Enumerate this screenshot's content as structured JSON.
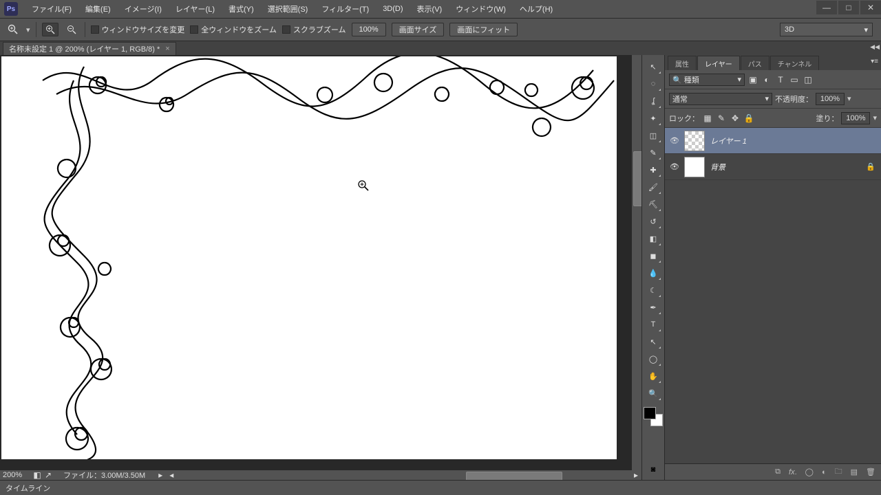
{
  "menu": [
    "ファイル(F)",
    "編集(E)",
    "イメージ(I)",
    "レイヤー(L)",
    "書式(Y)",
    "選択範囲(S)",
    "フィルター(T)",
    "3D(D)",
    "表示(V)",
    "ウィンドウ(W)",
    "ヘルプ(H)"
  ],
  "options": {
    "chk1": "ウィンドウサイズを変更",
    "chk2": "全ウィンドウをズーム",
    "chk3": "スクラブズーム",
    "btn100": "100%",
    "btnScreen": "画面サイズ",
    "btnFit": "画面にフィット",
    "mode": "3D"
  },
  "doc": {
    "title": "名称未設定 1 @ 200% (レイヤー 1, RGB/8) *"
  },
  "hbar": {
    "zoom": "200%",
    "file": "ファイル：3.00M/3.50M"
  },
  "panel": {
    "tabs": [
      "属性",
      "レイヤー",
      "パス",
      "チャンネル"
    ],
    "activeTab": 1,
    "filterKind": "種類",
    "blend": "通常",
    "opacityLabel": "不透明度：",
    "opacityVal": "100%",
    "fillLabel": "塗り：",
    "fillVal": "100%",
    "lockLabel": "ロック：",
    "layers": [
      {
        "name": "レイヤー 1",
        "sel": true,
        "trans": true,
        "locked": false
      },
      {
        "name": "背景",
        "sel": false,
        "trans": false,
        "locked": true
      }
    ]
  },
  "status": {
    "timeline": "タイムライン"
  }
}
